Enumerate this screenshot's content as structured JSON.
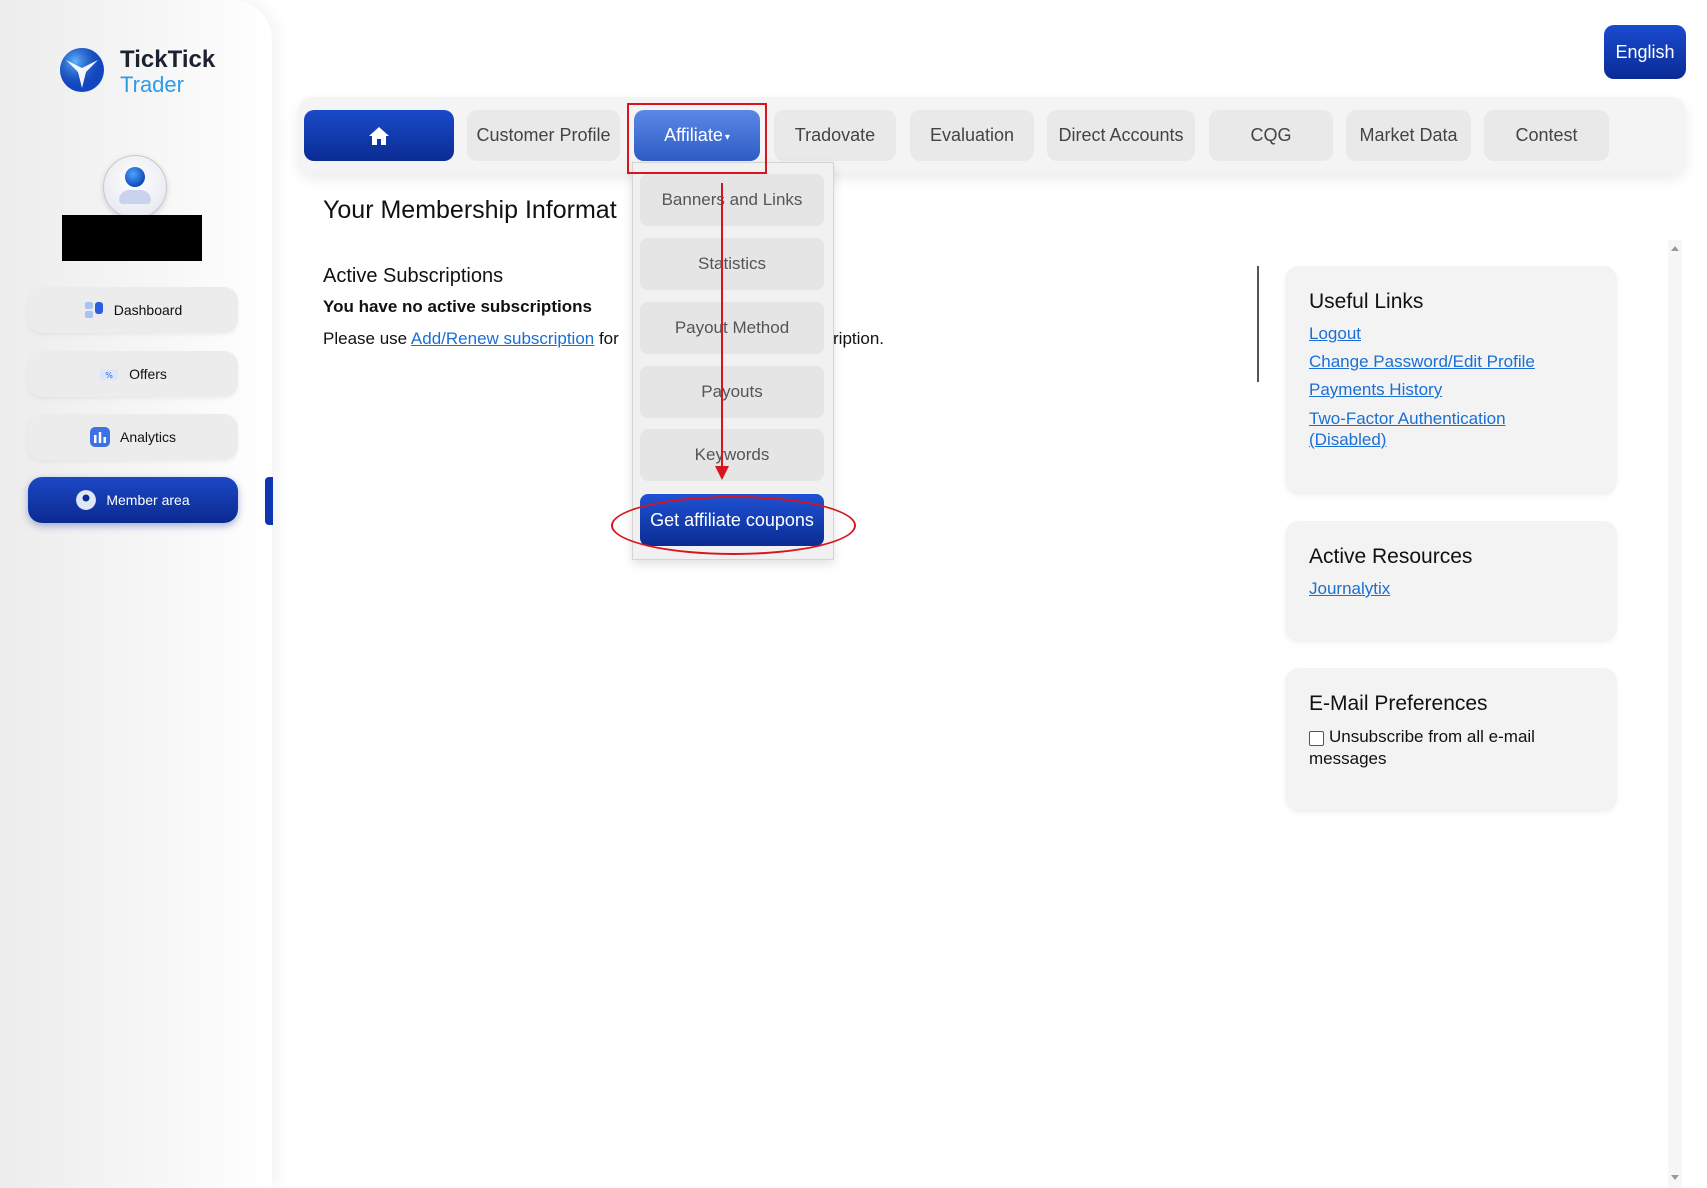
{
  "brand": {
    "name_line1": "TickTick",
    "name_line2": "Trader"
  },
  "sidebar": {
    "items": [
      {
        "label": "Dashboard",
        "icon": "dashboard-icon"
      },
      {
        "label": "Offers",
        "icon": "ticket-icon"
      },
      {
        "label": "Analytics",
        "icon": "bar-chart-icon"
      },
      {
        "label": "Member area",
        "icon": "member-icon",
        "active": true
      }
    ]
  },
  "language": {
    "label": "English"
  },
  "topnav": {
    "home_icon": "home-icon",
    "tabs": [
      "Customer Profile",
      "Affiliate",
      "Tradovate",
      "Evaluation",
      "Direct Accounts",
      "CQG",
      "Market Data",
      "Contest"
    ],
    "active": "Affiliate"
  },
  "affiliate_menu": {
    "items": [
      "Banners and Links",
      "Statistics",
      "Payout Method",
      "Payouts",
      "Keywords",
      "Get affiliate coupons"
    ]
  },
  "main": {
    "title": "Your Membership Informat",
    "subscriptions_heading": "Active Subscriptions",
    "no_subscriptions": "You have no active subscriptions",
    "use_prefix": "Please use ",
    "use_link": "Add/Renew subscription",
    "use_suffix": " for",
    "use_tail": "ription."
  },
  "useful_links": {
    "title": "Useful Links",
    "links": [
      "Logout",
      "Change Password/Edit Profile",
      "Payments History",
      "Two-Factor Authentication",
      "(Disabled)"
    ]
  },
  "active_resources": {
    "title": "Active Resources",
    "links": [
      "Journalytix"
    ]
  },
  "email_prefs": {
    "title": "E-Mail Preferences",
    "checkbox_label": "Unsubscribe from all e-mail messages",
    "checked": false
  },
  "colors": {
    "accent": "#0b2c93",
    "annotation": "#d8141c",
    "link": "#1a6fd6"
  }
}
